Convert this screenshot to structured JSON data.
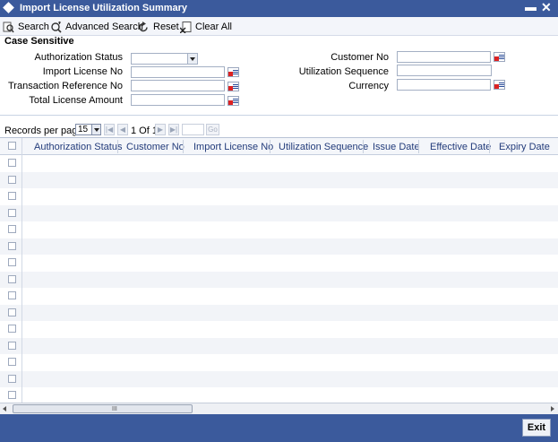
{
  "window": {
    "title": "Import License Utilization Summary",
    "minimize_glyph": "▬",
    "close_glyph": "✕"
  },
  "toolbar": {
    "search": "Search",
    "advanced_search": "Advanced Search",
    "reset": "Reset",
    "clear_all": "Clear All"
  },
  "criteria": {
    "section_title": "Case Sensitive",
    "authorization_status": "Authorization Status",
    "import_license_no": "Import License No",
    "transaction_reference_no": "Transaction Reference No",
    "total_license_amount": "Total License Amount",
    "customer_no": "Customer No",
    "utilization_sequence": "Utilization Sequence",
    "currency": "Currency"
  },
  "pager": {
    "records_per_page_label": "Records per page",
    "records_per_page_value": "15",
    "page_of": "1 Of 1",
    "first_glyph": "|◀",
    "prev_glyph": "◀",
    "next_glyph": "▶",
    "last_glyph": "▶|",
    "go_label": "Go"
  },
  "grid": {
    "columns": [
      "Authorization Status",
      "Customer No",
      "Import License No",
      "Utilization Sequence",
      "Issue Date",
      "Effective Date",
      "Expiry Date"
    ],
    "row_count": 15
  },
  "scrollbar": {
    "grip": "III"
  },
  "footer": {
    "exit": "Exit"
  }
}
